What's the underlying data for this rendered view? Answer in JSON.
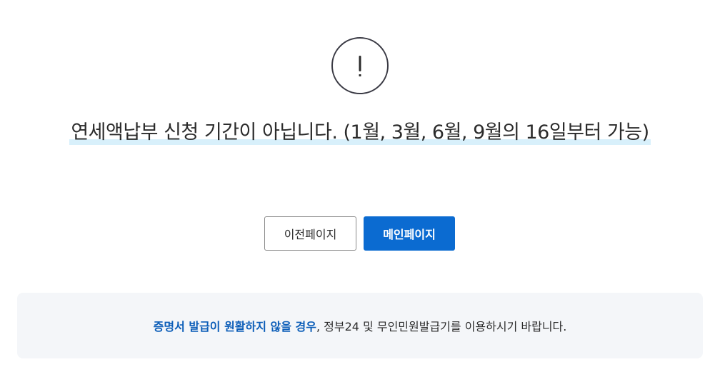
{
  "alert": {
    "icon": "exclamation-icon",
    "color": "#3a3a44"
  },
  "message": {
    "title": "연세액납부 신청 기간이 아닙니다. (1월, 3월, 6월, 9월의 16일부터 가능)"
  },
  "buttons": {
    "prev_label": "이전페이지",
    "main_label": "메인페이지",
    "main_color": "#0b6bd1"
  },
  "notice": {
    "highlight": "증명서 발급이 원활하지 않을 경우",
    "rest": ", 정부24 및 무인민원발급기를 이용하시기 바랍니다.",
    "highlight_color": "#0b5db8"
  }
}
